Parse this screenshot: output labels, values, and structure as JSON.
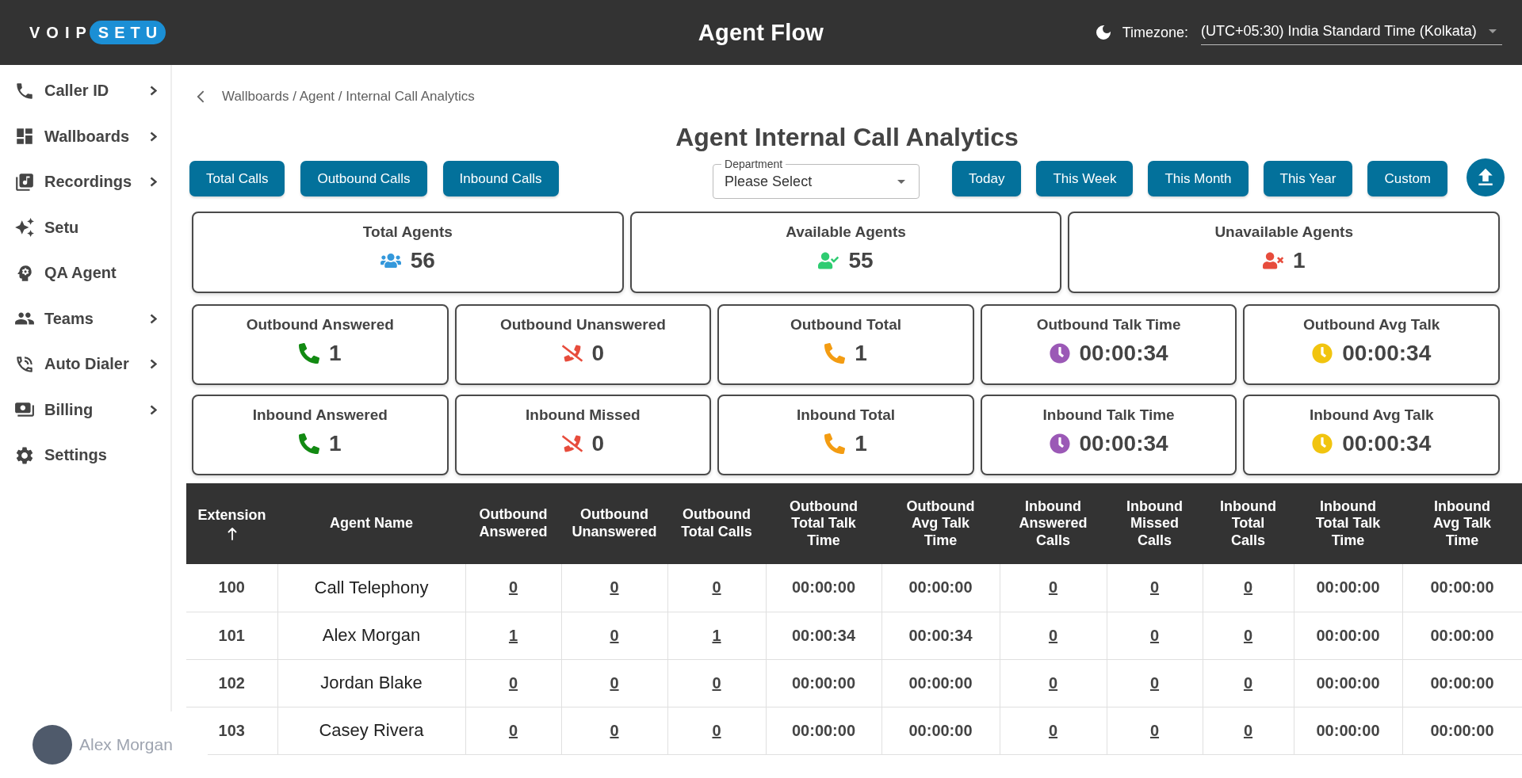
{
  "header": {
    "logo": {
      "text": "VOIP",
      "badge": "SETU"
    },
    "title": "Agent Flow",
    "timezone": {
      "label": "Timezone:",
      "value": "(UTC+05:30) India Standard Time (Kolkata)"
    }
  },
  "sidebar": {
    "items": [
      {
        "label": "Caller ID",
        "has_submenu": true
      },
      {
        "label": "Wallboards",
        "has_submenu": true
      },
      {
        "label": "Recordings",
        "has_submenu": true
      },
      {
        "label": "Setu",
        "has_submenu": false
      },
      {
        "label": "QA Agent",
        "has_submenu": false
      },
      {
        "label": "Teams",
        "has_submenu": true
      },
      {
        "label": "Auto Dialer",
        "has_submenu": true
      },
      {
        "label": "Billing",
        "has_submenu": true
      },
      {
        "label": "Settings",
        "has_submenu": false
      }
    ]
  },
  "user": {
    "name": "Alex Morgan"
  },
  "breadcrumb": "Wallboards / Agent / Internal Call Analytics",
  "page_title": "Agent Internal Call Analytics",
  "call_type_buttons": [
    "Total Calls",
    "Outbound Calls",
    "Inbound Calls"
  ],
  "department": {
    "label": "Department",
    "value": "Please Select"
  },
  "period_buttons": [
    "Today",
    "This Week",
    "This Month",
    "This Year",
    "Custom"
  ],
  "agent_stats": [
    {
      "title": "Total Agents",
      "value": "56",
      "kind": "all_agents"
    },
    {
      "title": "Available Agents",
      "value": "55",
      "kind": "available"
    },
    {
      "title": "Unavailable Agents",
      "value": "1",
      "kind": "unavailable"
    }
  ],
  "outbound_stats": [
    {
      "title": "Outbound Answered",
      "value": "1",
      "kind": "answered"
    },
    {
      "title": "Outbound Unanswered",
      "value": "0",
      "kind": "missed"
    },
    {
      "title": "Outbound Total",
      "value": "1",
      "kind": "total_calls"
    },
    {
      "title": "Outbound Talk Time",
      "value": "00:00:34",
      "kind": "talk_time"
    },
    {
      "title": "Outbound Avg Talk",
      "value": "00:00:34",
      "kind": "avg_talk"
    }
  ],
  "inbound_stats": [
    {
      "title": "Inbound Answered",
      "value": "1",
      "kind": "answered"
    },
    {
      "title": "Inbound Missed",
      "value": "0",
      "kind": "missed"
    },
    {
      "title": "Inbound Total",
      "value": "1",
      "kind": "total_calls"
    },
    {
      "title": "Inbound Talk Time",
      "value": "00:00:34",
      "kind": "talk_time"
    },
    {
      "title": "Inbound Avg Talk",
      "value": "00:00:34",
      "kind": "avg_talk"
    }
  ],
  "table": {
    "columns": [
      {
        "label": "Extension",
        "kind": "id",
        "sorted": true
      },
      {
        "label": "Agent Name",
        "kind": "name",
        "sorted": false
      },
      {
        "label": "Outbound Answered",
        "kind": "count",
        "sorted": false
      },
      {
        "label": "Outbound Unanswered",
        "kind": "count",
        "sorted": false
      },
      {
        "label": "Outbound Total Calls",
        "kind": "count",
        "sorted": false
      },
      {
        "label": "Outbound Total Talk Time",
        "kind": "time",
        "sorted": false
      },
      {
        "label": "Outbound Avg Talk Time",
        "kind": "time",
        "sorted": false
      },
      {
        "label": "Inbound Answered Calls",
        "kind": "count",
        "sorted": false
      },
      {
        "label": "Inbound Missed Calls",
        "kind": "count",
        "sorted": false
      },
      {
        "label": "Inbound Total Calls",
        "kind": "count",
        "sorted": false
      },
      {
        "label": "Inbound Total Talk Time",
        "kind": "time",
        "sorted": false
      },
      {
        "label": "Inbound Avg Talk Time",
        "kind": "time",
        "sorted": false
      }
    ],
    "rows": [
      [
        "100",
        "Call Telephony",
        "0",
        "0",
        "0",
        "00:00:00",
        "00:00:00",
        "0",
        "0",
        "0",
        "00:00:00",
        "00:00:00"
      ],
      [
        "101",
        "Alex Morgan",
        "1",
        "0",
        "1",
        "00:00:34",
        "00:00:34",
        "0",
        "0",
        "0",
        "00:00:00",
        "00:00:00"
      ],
      [
        "102",
        "Jordan Blake",
        "0",
        "0",
        "0",
        "00:00:00",
        "00:00:00",
        "0",
        "0",
        "0",
        "00:00:00",
        "00:00:00"
      ],
      [
        "103",
        "Casey Rivera",
        "0",
        "0",
        "0",
        "00:00:00",
        "00:00:00",
        "0",
        "0",
        "0",
        "00:00:00",
        "00:00:00"
      ]
    ]
  }
}
